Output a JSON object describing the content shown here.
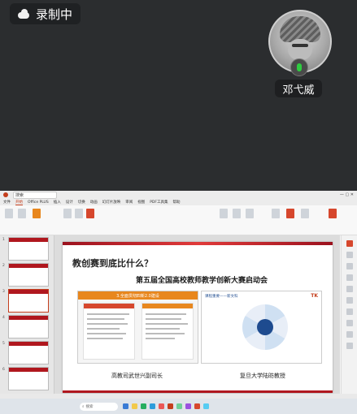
{
  "recording": {
    "label": "录制中"
  },
  "participant": {
    "name": "邓弋威"
  },
  "presentation": {
    "titlebar": {
      "search_placeholder": "搜索"
    },
    "menus": [
      "文件",
      "开始",
      "Office PLUS",
      "插入",
      "设计",
      "切换",
      "动画",
      "幻灯片放映",
      "审阅",
      "视图",
      "PDF工具集",
      "帮助"
    ],
    "active_menu": "开始",
    "slide_numbers": [
      "1",
      "2",
      "3",
      "4",
      "5",
      "6"
    ],
    "slide": {
      "title": "教创赛到底比什么？",
      "subtitle": "第五届全国高校教师教学创新大赛启动会",
      "left_panel_header": "3.全面贯彻四新2.0建设",
      "right_panel_header": "课程重要——新文科",
      "right_panel_logo": "TK",
      "caption_left": "高教司武世兴副司长",
      "caption_right": "复旦大学陆昉教授"
    },
    "taskbar": {
      "search_label": "搜索"
    }
  },
  "colors": {
    "accent_red": "#b0171e",
    "mic_green": "#2ecc40"
  },
  "icons": [
    "cloud-icon",
    "microphone-icon",
    "search-icon"
  ]
}
